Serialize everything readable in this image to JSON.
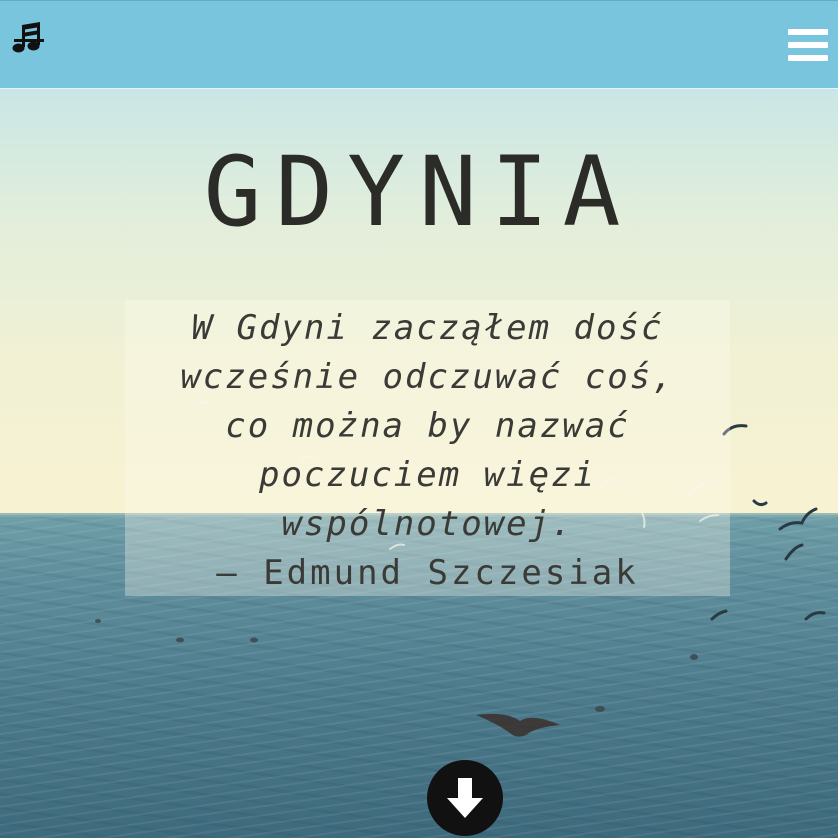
{
  "header": {
    "logo_icon": "music-notes-icon",
    "menu_icon": "hamburger-menu-icon",
    "background_color": "#79c5de"
  },
  "hero": {
    "title": "GDYNIA",
    "quote_lines": [
      "W Gdyni zacząłem dość",
      "wcześnie odczuwać coś,",
      "co można by nazwać",
      "poczuciem więzi",
      "wspólnotowej."
    ],
    "quote_author": "— Edmund Szczesiak",
    "scroll_down_icon": "arrow-down-circle-icon"
  }
}
